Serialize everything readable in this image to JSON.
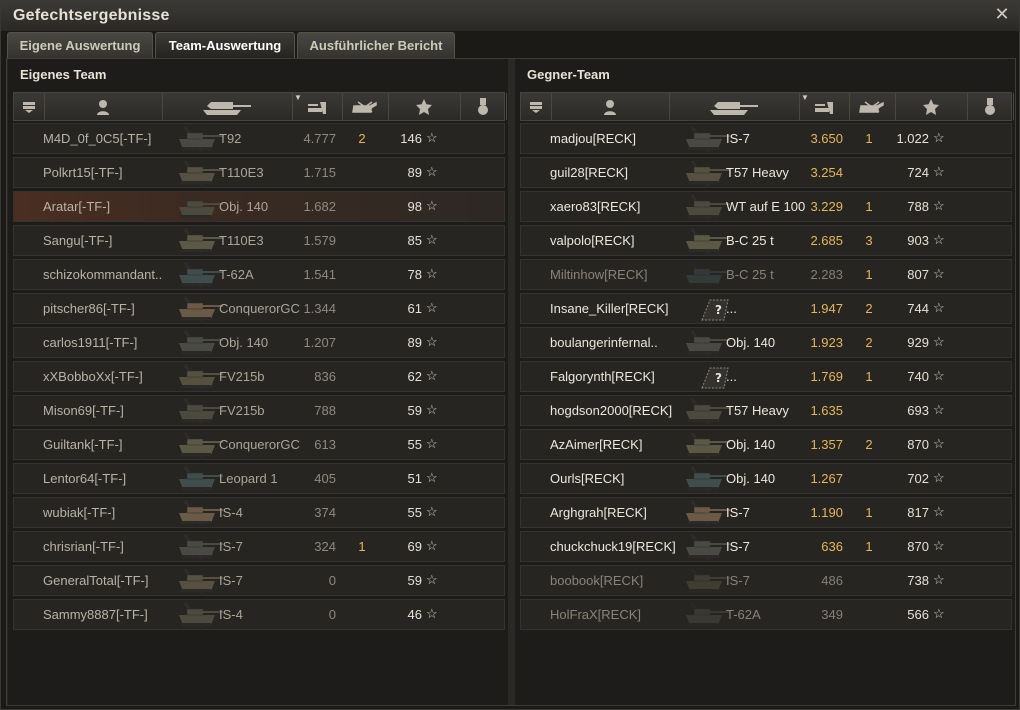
{
  "window": {
    "title": "Gefechtsergebnisse"
  },
  "tabs": [
    {
      "label": "Eigene Auswertung"
    },
    {
      "label": "Team-Auswertung"
    },
    {
      "label": "Ausführlicher Bericht"
    }
  ],
  "active_tab": "Team-Auswertung",
  "own_team": {
    "title": "Eigenes Team",
    "players": [
      {
        "name": "M4D_0f_0C5[-TF-]",
        "vehicle": "T92",
        "damage": "4.777",
        "frags": "2",
        "xp": "146",
        "dead": false
      },
      {
        "name": "Polkrt15[-TF-]",
        "vehicle": "T110E3",
        "damage": "1.715",
        "frags": "",
        "xp": "89",
        "dead": false
      },
      {
        "name": "Aratar[-TF-]",
        "vehicle": "Obj. 140",
        "damage": "1.682",
        "frags": "",
        "xp": "98",
        "dead": false,
        "me": true
      },
      {
        "name": "Sangu[-TF-]",
        "vehicle": "T110E3",
        "damage": "1.579",
        "frags": "",
        "xp": "85",
        "dead": false
      },
      {
        "name": "schizokommandant..",
        "vehicle": "T-62A",
        "damage": "1.541",
        "frags": "",
        "xp": "78",
        "dead": false
      },
      {
        "name": "pitscher86[-TF-]",
        "vehicle": "ConquerorGC",
        "damage": "1.344",
        "frags": "",
        "xp": "61",
        "dead": false
      },
      {
        "name": "carlos1911[-TF-]",
        "vehicle": "Obj. 140",
        "damage": "1.207",
        "frags": "",
        "xp": "89",
        "dead": false
      },
      {
        "name": "xXBobboXx[-TF-]",
        "vehicle": "FV215b",
        "damage": "836",
        "frags": "",
        "xp": "62",
        "dead": false
      },
      {
        "name": "Mison69[-TF-]",
        "vehicle": "FV215b",
        "damage": "788",
        "frags": "",
        "xp": "59",
        "dead": false
      },
      {
        "name": "Guiltank[-TF-]",
        "vehicle": "ConquerorGC",
        "damage": "613",
        "frags": "",
        "xp": "55",
        "dead": false
      },
      {
        "name": "Lentor64[-TF-]",
        "vehicle": "Leopard 1",
        "damage": "405",
        "frags": "",
        "xp": "51",
        "dead": false
      },
      {
        "name": "wubiak[-TF-]",
        "vehicle": "IS-4",
        "damage": "374",
        "frags": "",
        "xp": "55",
        "dead": false
      },
      {
        "name": "chrisrian[-TF-]",
        "vehicle": "IS-7",
        "damage": "324",
        "frags": "1",
        "xp": "69",
        "dead": false
      },
      {
        "name": "GeneralTotal[-TF-]",
        "vehicle": "IS-7",
        "damage": "0",
        "frags": "",
        "xp": "59",
        "dead": false
      },
      {
        "name": "Sammy8887[-TF-]",
        "vehicle": "IS-4",
        "damage": "0",
        "frags": "",
        "xp": "46",
        "dead": false
      }
    ]
  },
  "enemy_team": {
    "title": "Gegner-Team",
    "players": [
      {
        "name": "madjou[RECK]",
        "vehicle": "IS-7",
        "damage": "3.650",
        "frags": "1",
        "xp": "1.022",
        "dead": false
      },
      {
        "name": "guil28[RECK]",
        "vehicle": "T57 Heavy",
        "damage": "3.254",
        "frags": "",
        "xp": "724",
        "dead": false
      },
      {
        "name": "xaero83[RECK]",
        "vehicle": "WT auf E 100",
        "damage": "3.229",
        "frags": "1",
        "xp": "788",
        "dead": false
      },
      {
        "name": "valpolo[RECK]",
        "vehicle": "B-C 25 t",
        "damage": "2.685",
        "frags": "3",
        "xp": "903",
        "dead": false
      },
      {
        "name": "Miltinhow[RECK]",
        "vehicle": "B-C 25 t",
        "damage": "2.283",
        "frags": "1",
        "xp": "807",
        "dead": true
      },
      {
        "name": "Insane_Killer[RECK]",
        "vehicle": "...",
        "damage": "1.947",
        "frags": "2",
        "xp": "744",
        "dead": false,
        "unknown": true
      },
      {
        "name": "boulangerinfernal..",
        "vehicle": "Obj. 140",
        "damage": "1.923",
        "frags": "2",
        "xp": "929",
        "dead": false
      },
      {
        "name": "Falgorynth[RECK]",
        "vehicle": "...",
        "damage": "1.769",
        "frags": "1",
        "xp": "740",
        "dead": false,
        "unknown": true
      },
      {
        "name": "hogdson2000[RECK]",
        "vehicle": "T57 Heavy",
        "damage": "1.635",
        "frags": "",
        "xp": "693",
        "dead": false
      },
      {
        "name": "AzAimer[RECK]",
        "vehicle": "Obj. 140",
        "damage": "1.357",
        "frags": "2",
        "xp": "870",
        "dead": false
      },
      {
        "name": "Ourls[RECK]",
        "vehicle": "Obj. 140",
        "damage": "1.267",
        "frags": "",
        "xp": "702",
        "dead": false
      },
      {
        "name": "Arghgrah[RECK]",
        "vehicle": "IS-7",
        "damage": "1.190",
        "frags": "1",
        "xp": "817",
        "dead": false
      },
      {
        "name": "chuckchuck19[RECK]",
        "vehicle": "IS-7",
        "damage": "636",
        "frags": "1",
        "xp": "870",
        "dead": false
      },
      {
        "name": "boobook[RECK]",
        "vehicle": "IS-7",
        "damage": "486",
        "frags": "",
        "xp": "738",
        "dead": true
      },
      {
        "name": "HolFraX[RECK]",
        "vehicle": "T-62A",
        "damage": "349",
        "frags": "",
        "xp": "566",
        "dead": true
      }
    ]
  },
  "icons": {
    "close": "close-icon",
    "header": [
      "platoon-icon",
      "player-icon",
      "tank-icon",
      "damage-icon",
      "frags-icon",
      "xp-star-icon",
      "medal-icon"
    ],
    "row": [
      "tank-silhouette-icon",
      "star-icon",
      "unknown-vehicle-icon"
    ]
  },
  "colors": {
    "damage": "#e6b659",
    "frags": "#e6b659",
    "me_row": "#4a2e22",
    "dead_text": "#8e887c"
  }
}
